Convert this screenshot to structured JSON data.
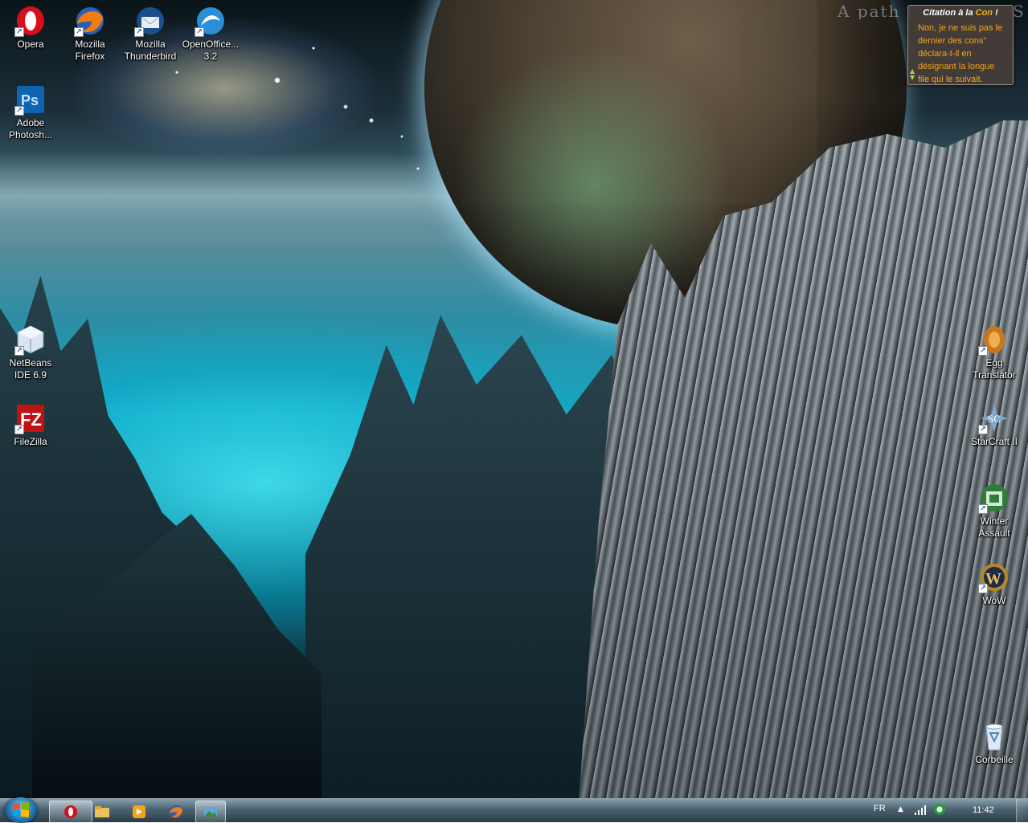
{
  "desktop": {
    "wallpaper_text_start": "A path t",
    "wallpaper_text_end": "S",
    "icons_left": [
      {
        "label": "Opera",
        "icon": "opera-icon"
      },
      {
        "label": "Mozilla Firefox",
        "icon": "firefox-icon"
      },
      {
        "label": "Mozilla Thunderbird",
        "icon": "thunderbird-icon"
      },
      {
        "label": "OpenOffice... 3.2",
        "icon": "openoffice-icon"
      },
      {
        "label": "Adobe Photosh...",
        "icon": "photoshop-icon"
      },
      {
        "label": "NetBeans IDE 6.9",
        "icon": "netbeans-icon"
      },
      {
        "label": "FileZilla",
        "icon": "filezilla-icon"
      }
    ],
    "icons_right": [
      {
        "label": "Egg Translator",
        "icon": "egg-translator-icon"
      },
      {
        "label": "StarCraft II",
        "icon": "starcraft-icon"
      },
      {
        "label": "Winter Assault",
        "icon": "winter-assault-icon"
      },
      {
        "label": "WoW",
        "icon": "wow-icon"
      },
      {
        "label": "Corbeille",
        "icon": "recycle-bin-icon"
      }
    ]
  },
  "gadget": {
    "title_prefix": "Citation à la ",
    "title_con": "Con",
    "title_suffix": " !",
    "quote": "Non, je ne suis pas le dernier des cons\" déclara-t-il en désignant la longue file qui le suivait."
  },
  "taskbar": {
    "pinned": [
      "opera-icon",
      "explorer-icon",
      "media-player-icon",
      "firefox-icon",
      "desktop-app-icon"
    ],
    "language": "FR",
    "time": "11:42"
  },
  "colors": {
    "gadget_text": "#f2a51c",
    "gadget_accent": "#f3b31a",
    "opera_red": "#d6101a"
  }
}
